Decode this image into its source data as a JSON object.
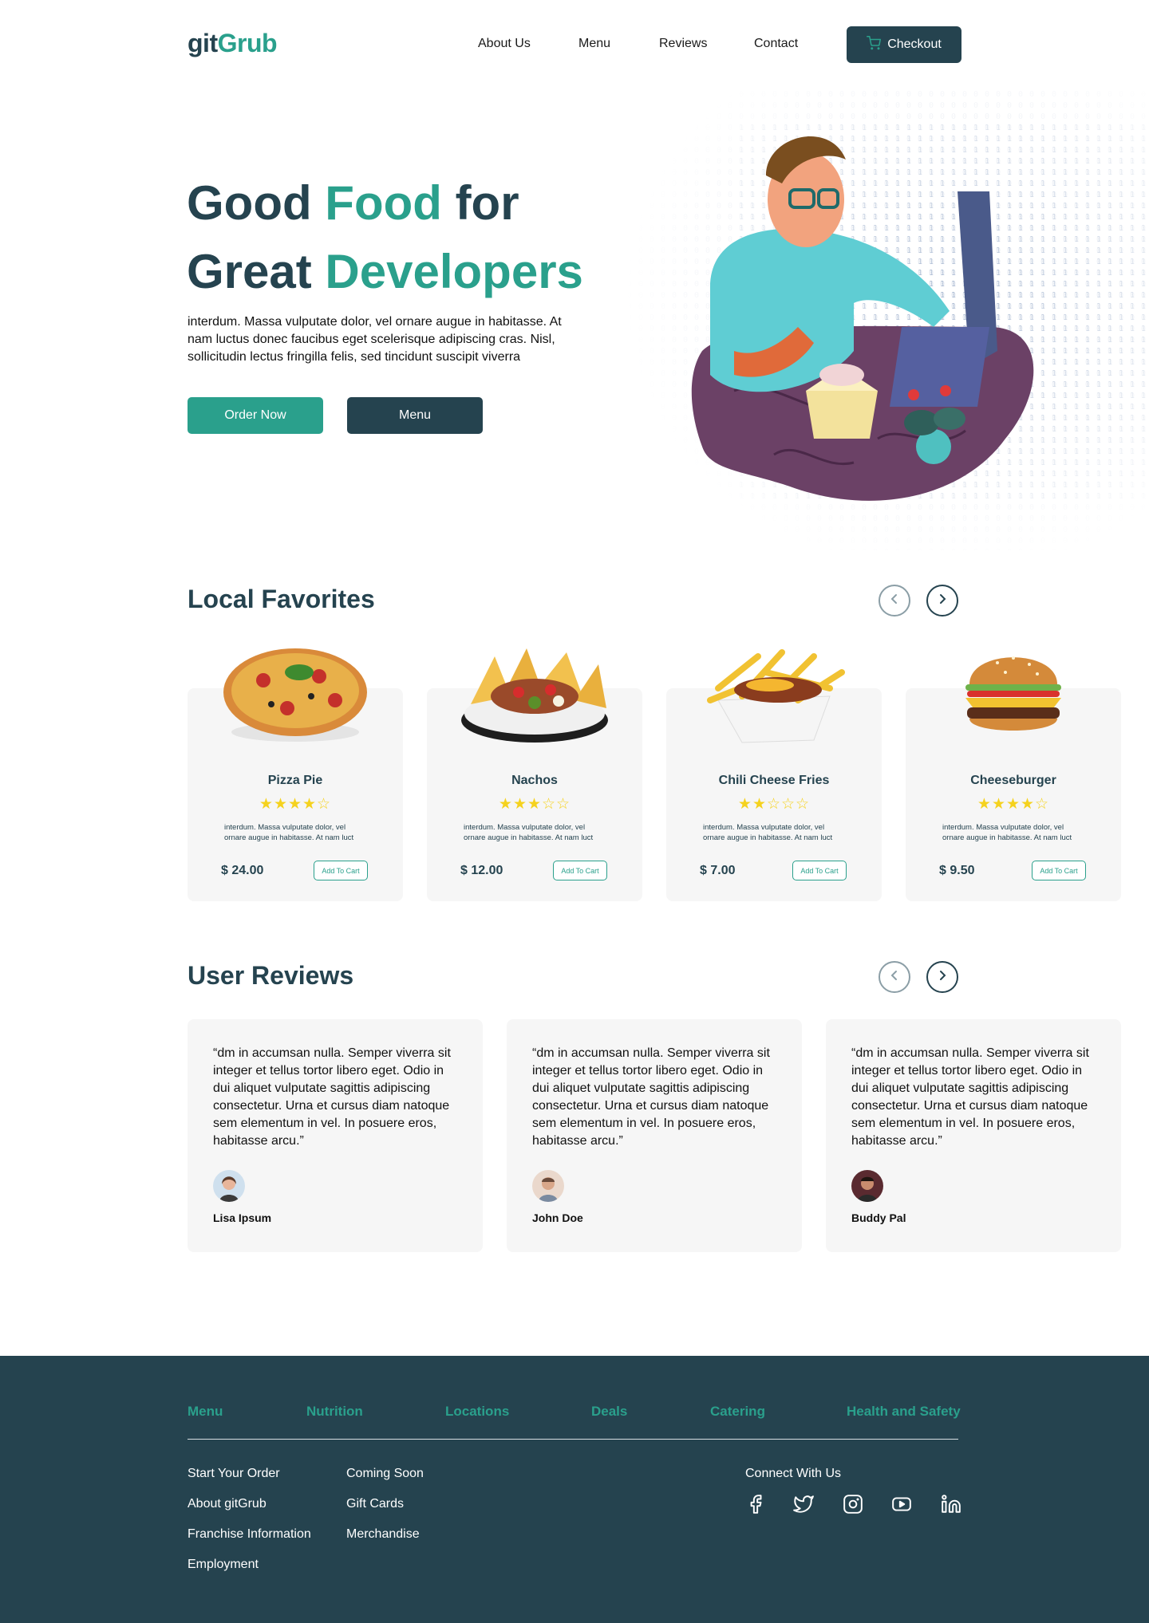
{
  "header": {
    "logo_part1": "git",
    "logo_part2": "Grub",
    "nav": [
      "About Us",
      "Menu",
      "Reviews",
      "Contact"
    ],
    "checkout_label": "Checkout"
  },
  "hero": {
    "title_line1_a": "Good ",
    "title_line1_b": "Food",
    "title_line1_c": " for",
    "title_line2_a": "Great ",
    "title_line2_b": "Developers",
    "text": "interdum. Massa vulputate dolor, vel ornare augue in habitasse. At nam luctus donec faucibus eget scelerisque adipiscing cras. Nisl, sollicitudin lectus fringilla felis, sed tincidunt suscipit viverra",
    "order_label": "Order Now",
    "menu_label": "Menu"
  },
  "favorites": {
    "title": "Local Favorites",
    "items": [
      {
        "name": "Pizza Pie",
        "rating": 4,
        "stars": "★★★★☆",
        "desc": "interdum. Massa vulputate dolor, vel ornare augue in habitasse. At nam luct",
        "price": "$ 24.00",
        "cta": "Add To Cart"
      },
      {
        "name": "Nachos",
        "rating": 3,
        "stars": "★★★☆☆",
        "desc": "interdum. Massa vulputate dolor, vel ornare augue in habitasse. At nam luct",
        "price": "$ 12.00",
        "cta": "Add To Cart"
      },
      {
        "name": "Chili Cheese Fries",
        "rating": 2,
        "stars": "★★☆☆☆",
        "desc": "interdum. Massa vulputate dolor, vel ornare augue in habitasse. At nam luct",
        "price": "$ 7.00",
        "cta": "Add To Cart"
      },
      {
        "name": "Cheeseburger",
        "rating": 4,
        "stars": "★★★★☆",
        "desc": "interdum. Massa vulputate dolor, vel ornare augue in habitasse. At nam luct",
        "price": "$ 9.50",
        "cta": "Add To Cart"
      }
    ]
  },
  "reviews": {
    "title": "User Reviews",
    "items": [
      {
        "text": "“dm in accumsan nulla. Semper viverra sit integer et tellus tortor libero eget. Odio in dui aliquet vulputate sagittis adipiscing consectetur. Urna et cursus diam natoque sem elementum in vel. In posuere eros, habitasse arcu.”",
        "name": "Lisa Ipsum"
      },
      {
        "text": "“dm in accumsan nulla. Semper viverra sit integer et tellus tortor libero eget. Odio in dui aliquet vulputate sagittis adipiscing consectetur. Urna et cursus diam natoque sem elementum in vel. In posuere eros, habitasse arcu.”",
        "name": "John Doe"
      },
      {
        "text": "“dm in accumsan nulla. Semper viverra sit integer et tellus tortor libero eget. Odio in dui aliquet vulputate sagittis adipiscing consectetur. Urna et cursus diam natoque sem elementum in vel. In posuere eros, habitasse arcu.”",
        "name": "Buddy Pal"
      }
    ]
  },
  "footer": {
    "categories": [
      "Menu",
      "Nutrition",
      "Locations",
      "Deals",
      "Catering",
      "Health and Safety"
    ],
    "col1": [
      "Start Your Order",
      "About gitGrub",
      "Franchise Information",
      "Employment"
    ],
    "col2": [
      "Coming Soon",
      "Gift Cards",
      "Merchandise"
    ],
    "connect": "Connect With Us",
    "social_icons": [
      "facebook-icon",
      "twitter-icon",
      "instagram-icon",
      "youtube-icon",
      "linkedin-icon"
    ]
  },
  "colors": {
    "primary_dark": "#25434f",
    "accent_green": "#2aa08c",
    "star_yellow": "#f5d21e",
    "card_bg": "#f6f6f6"
  }
}
